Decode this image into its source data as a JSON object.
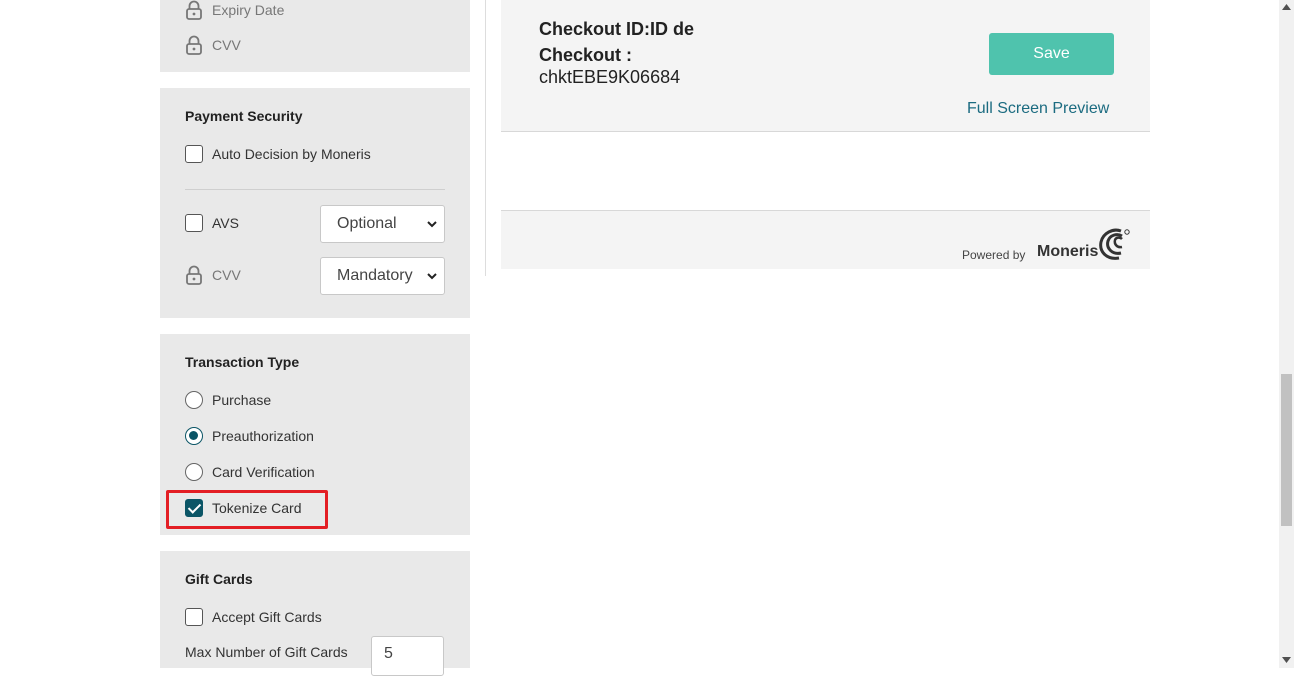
{
  "card_fields_panel": {
    "expiry_label": "Expiry Date",
    "cvv_label": "CVV"
  },
  "payment_security": {
    "title": "Payment Security",
    "auto_decision_label": "Auto Decision by Moneris",
    "auto_decision_checked": false,
    "avs_label": "AVS",
    "avs_checked": false,
    "avs_select_value": "Optional",
    "cvv_label": "CVV",
    "cvv_select_value": "Mandatory"
  },
  "transaction_type": {
    "title": "Transaction Type",
    "options": [
      "Purchase",
      "Preauthorization",
      "Card Verification"
    ],
    "selected": "Preauthorization",
    "tokenize_label": "Tokenize Card",
    "tokenize_checked": true
  },
  "gift_cards": {
    "title": "Gift Cards",
    "accept_label": "Accept Gift Cards",
    "accept_checked": false,
    "max_label": "Max Number of Gift Cards",
    "max_value": "5"
  },
  "preview": {
    "checkout_id_line1": "Checkout ID:ID de",
    "checkout_id_line2": "Checkout :",
    "checkout_id_value": "chktEBE9K06684",
    "save_label": "Save",
    "full_screen_label": "Full Screen Preview",
    "powered_by": "Powered by",
    "brand": "Moneris"
  },
  "colors": {
    "accent": "#0b5566",
    "save_button": "#4fc3ad",
    "link": "#1b6b80",
    "highlight": "#e31e24"
  },
  "icons": {
    "lock": "lock-icon",
    "chevron": "chevron-down-icon",
    "logo": "moneris-swirl-logo"
  }
}
